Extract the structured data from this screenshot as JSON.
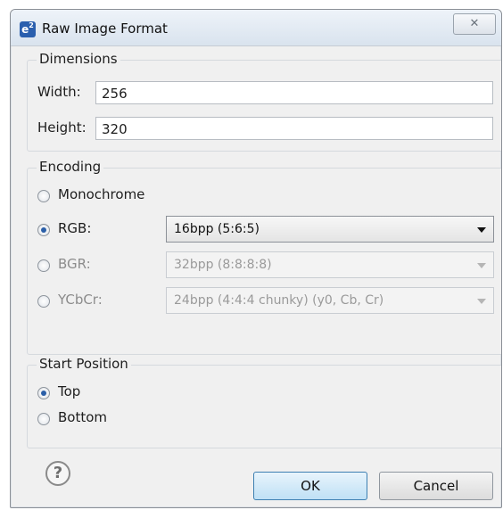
{
  "window": {
    "title": "Raw Image Format",
    "app_icon_text": "e",
    "app_icon_sup": "2",
    "close_glyph": "✕"
  },
  "dimensions": {
    "group_label": "Dimensions",
    "width_label": "Width:",
    "width_value": "256",
    "height_label": "Height:",
    "height_value": "320"
  },
  "encoding": {
    "group_label": "Encoding",
    "options": [
      {
        "label": "Monochrome",
        "selected": false
      },
      {
        "label": "RGB:",
        "selected": true,
        "format": "16bpp (5:6:5)",
        "enabled": true
      },
      {
        "label": "BGR:",
        "selected": false,
        "format": "32bpp (8:8:8:8)",
        "enabled": false
      },
      {
        "label": "YCbCr:",
        "selected": false,
        "format": "24bpp (4:4:4 chunky) (y0, Cb, Cr)",
        "enabled": false
      }
    ]
  },
  "start_position": {
    "group_label": "Start Position",
    "options": [
      {
        "label": "Top",
        "selected": true
      },
      {
        "label": "Bottom",
        "selected": false
      }
    ]
  },
  "footer": {
    "help_glyph": "?",
    "ok_label": "OK",
    "cancel_label": "Cancel"
  },
  "colors": {
    "dialog_bg": "#f0f0f0",
    "accent": "#2b5fa8",
    "ok_button_border": "#3c7fb1"
  }
}
